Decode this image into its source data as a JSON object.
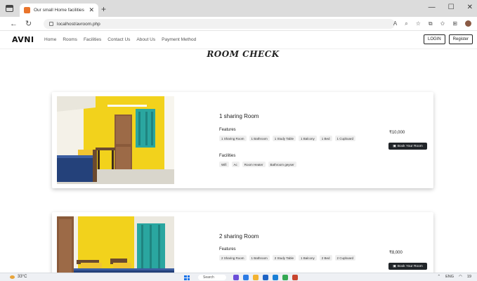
{
  "browser": {
    "tab_title": "Our small Home facilities",
    "tab_close": "✕",
    "new_tab": "+",
    "url": "localhost/avroom.php",
    "window_controls": [
      "—",
      "☐",
      "✕"
    ]
  },
  "site": {
    "brand": "AVNI",
    "menu": [
      "Home",
      "Rooms",
      "Facilities",
      "Contact Us",
      "About Us",
      "Payment Method"
    ],
    "login_label": "LOGIN",
    "register_label": "Register"
  },
  "page": {
    "title": "ROOM CHECK"
  },
  "rooms": [
    {
      "name": "1 sharing Room",
      "features_heading": "Features",
      "features": [
        "1 Sharing Room",
        "1 Bathroom",
        "1 Study Table",
        "1 Balcony",
        "1 Bed",
        "1 Cupboard"
      ],
      "facilities_heading": "Facilities",
      "facilities": [
        "Wifi",
        "Ac",
        "Room Heater",
        "Bathroom geyser"
      ],
      "price": "₹10,000",
      "book_label": "Book Your Room"
    },
    {
      "name": "2 sharing Room",
      "features_heading": "Features",
      "features": [
        "2 Sharing Room",
        "1 Bathroom",
        "2 Study Table",
        "1 Balcony",
        "2 Bed",
        "2 Cupboard"
      ],
      "price": "₹8,000",
      "book_label": "Book Your Room"
    }
  ],
  "taskbar": {
    "temperature": "33°C",
    "search_label": "Search",
    "language": "ENG",
    "time": "19"
  },
  "colors": {
    "wall_yellow": "#f2d21c",
    "button_dark": "#212529",
    "curtain_teal": "#2aa6a0"
  }
}
